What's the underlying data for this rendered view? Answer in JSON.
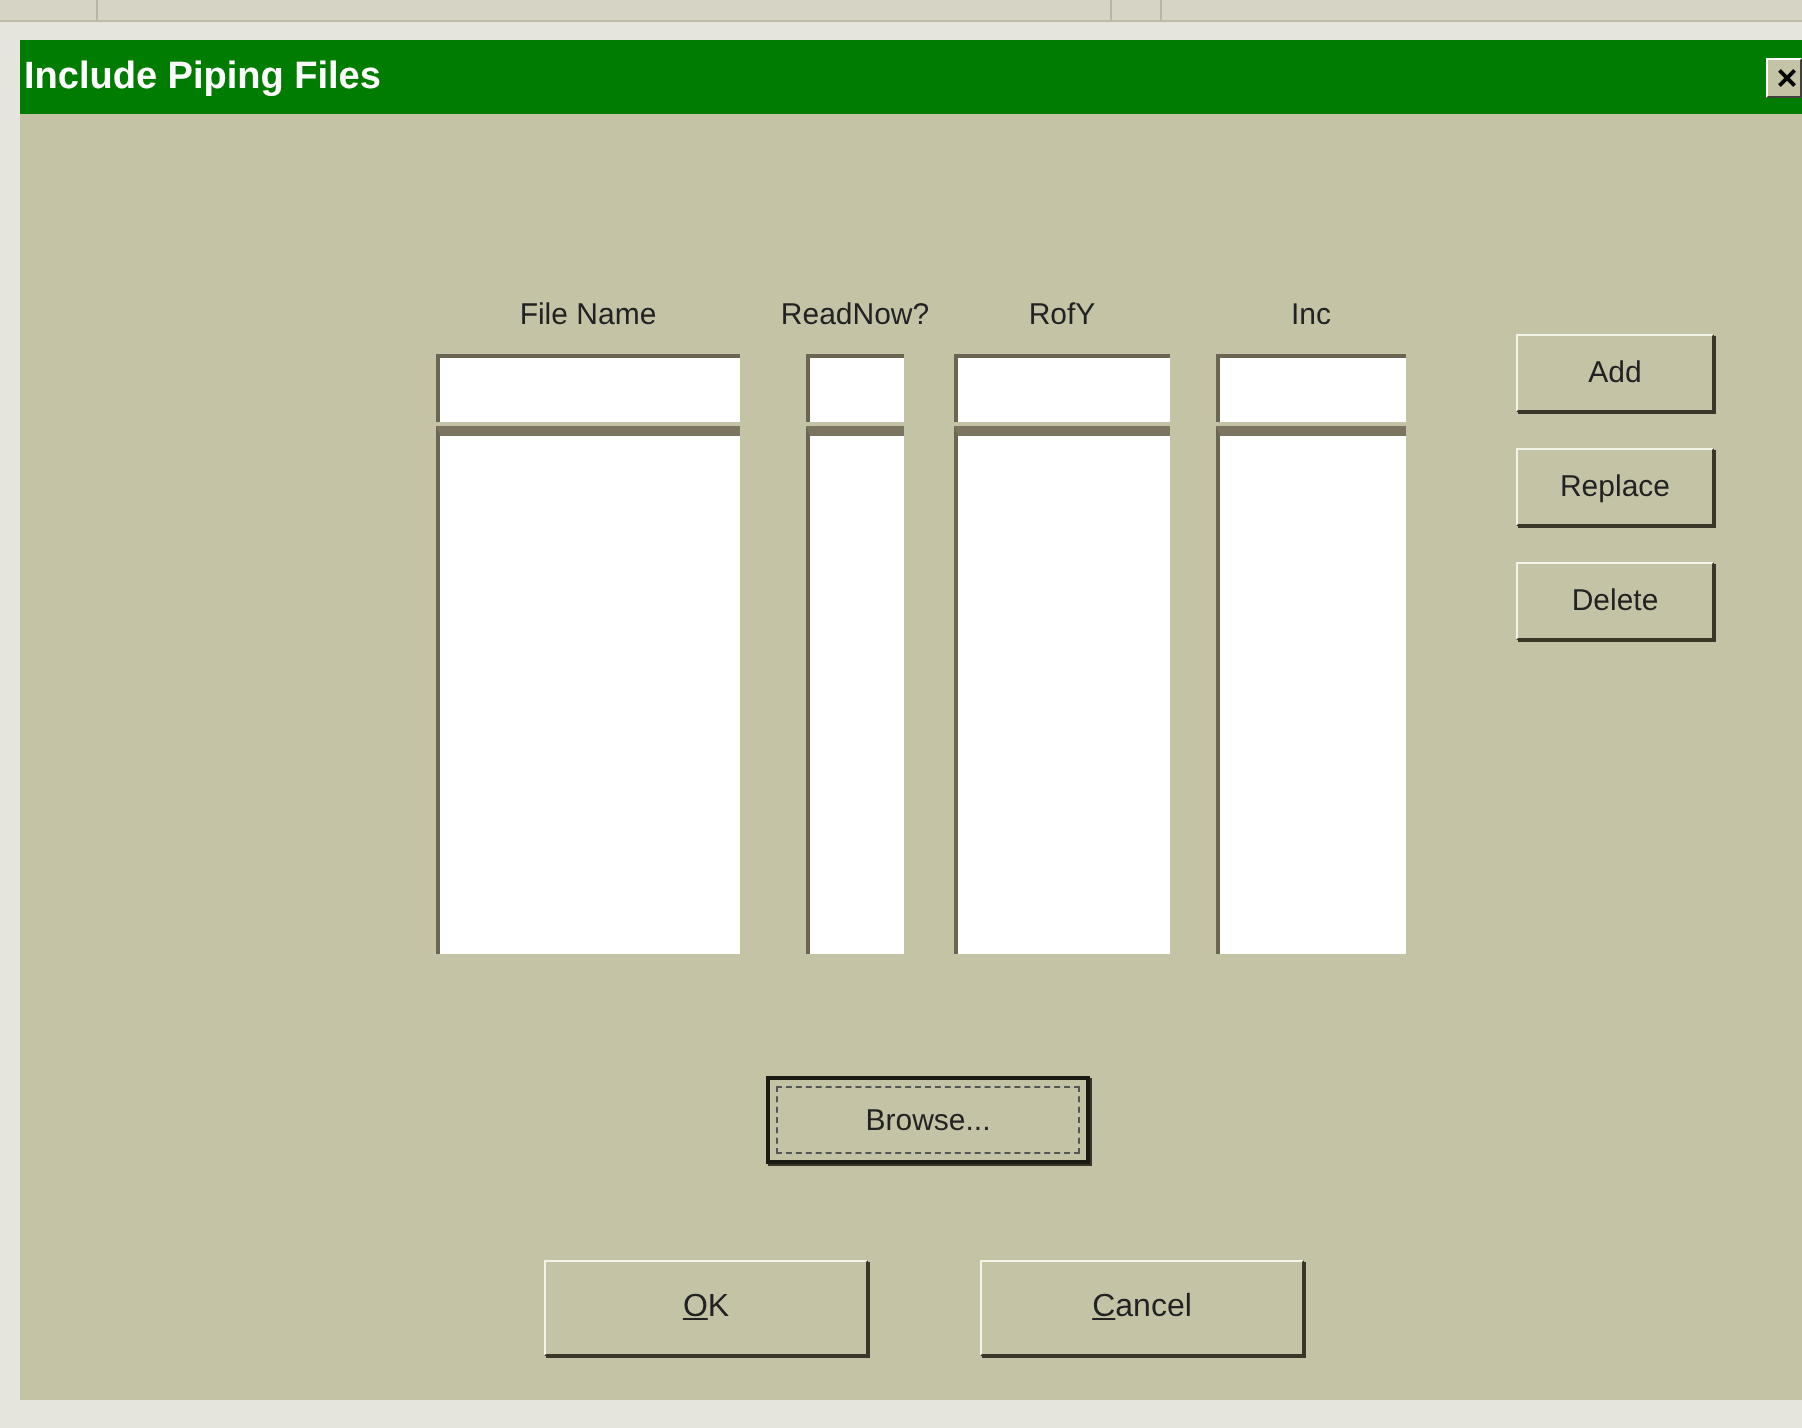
{
  "window": {
    "title": "Include Piping Files",
    "close": "×"
  },
  "columns": [
    {
      "header": "File Name"
    },
    {
      "header": "ReadNow?"
    },
    {
      "header": "RofY"
    },
    {
      "header": "Inc"
    }
  ],
  "side_buttons": [
    "Add",
    "Replace",
    "Delete"
  ],
  "browse_button": {
    "label": "Browse...",
    "focused": true
  },
  "footer_buttons": [
    {
      "label": "OK",
      "underline_first": true
    },
    {
      "label": "Cancel",
      "underline_first": true
    }
  ]
}
